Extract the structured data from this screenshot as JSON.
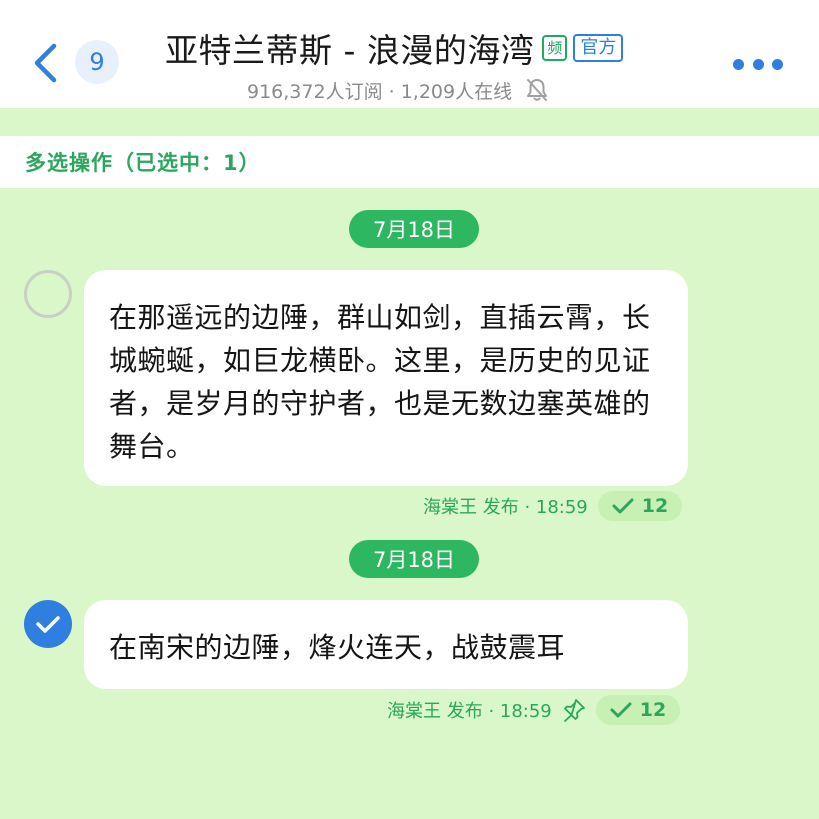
{
  "header": {
    "title": "亚特兰蒂斯 - 浪漫的海湾",
    "tag_pin": "频",
    "tag_official": "官方",
    "unread_count": "9",
    "subtitle": "916,372人订阅 · 1,209人在线"
  },
  "select_bar": {
    "label": "多选操作（已选中：1）"
  },
  "messages": [
    {
      "date": "7月18日",
      "text": "在那遥远的边陲，群山如剑，直插云霄，长城蜿蜒，如巨龙横卧。这里，是历史的见证者，是岁月的守护者，也是无数边塞英雄的舞台。",
      "meta": "海棠王 发布 · 18:59",
      "read_count": "12",
      "selected": false,
      "pinned": false
    },
    {
      "date": "7月18日",
      "text": "在南宋的边陲，烽火连天，战鼓震耳",
      "meta": "海棠王 发布 · 18:59",
      "read_count": "12",
      "selected": true,
      "pinned": true
    }
  ],
  "colors": {
    "background": "#d9f7c8",
    "accent_green": "#2eb761",
    "accent_blue": "#2f7fe0"
  }
}
